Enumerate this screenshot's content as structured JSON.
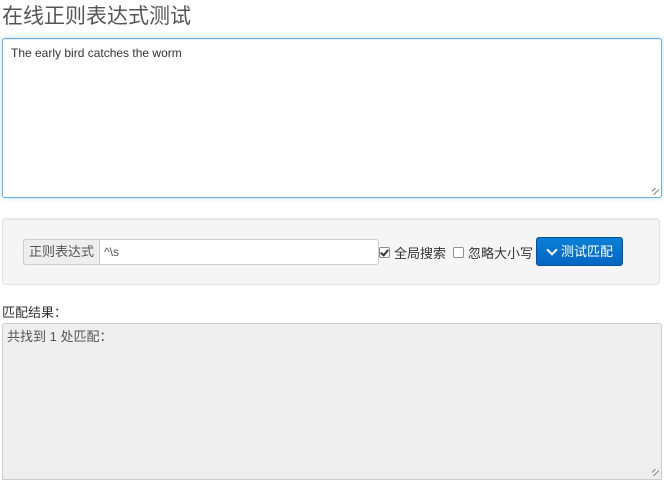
{
  "page": {
    "title": "在线正则表达式测试"
  },
  "test_text": {
    "value": "The early bird catches the worm"
  },
  "regex": {
    "label": "正则表达式",
    "value": "^\\s",
    "global_search": {
      "label": "全局搜索",
      "checked": true
    },
    "ignore_case": {
      "label": "忽略大小写",
      "checked": false
    },
    "test_button_label": "测试匹配",
    "test_button_icon": "chevron-down-icon"
  },
  "result": {
    "label": "匹配结果：",
    "text": "共找到 1 处匹配："
  },
  "colors": {
    "button": "#0566c2",
    "focus_border": "#66afe9",
    "result_background": "#eeeeee",
    "well_background": "#f5f5f5"
  }
}
